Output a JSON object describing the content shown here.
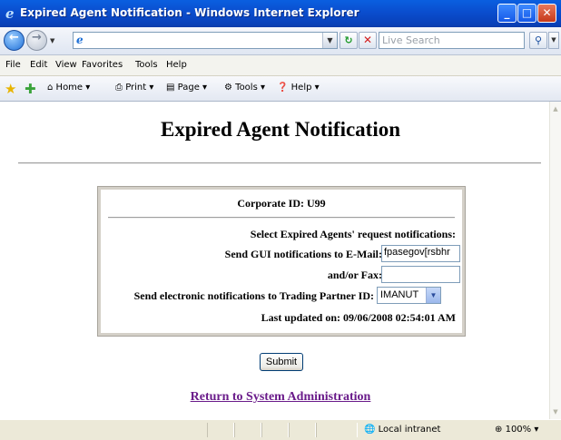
{
  "window": {
    "title": "Expired Agent Notification - Windows Internet Explorer",
    "minimize": "_",
    "maximize": "□",
    "close": "✕"
  },
  "address_bar": {
    "search_placeholder": "Live Search"
  },
  "menu": {
    "items": [
      "File",
      "Edit",
      "View",
      "Favorites",
      "Tools",
      "Help"
    ]
  },
  "command_bar": {
    "home": "Home",
    "print": "Print",
    "page": "Page",
    "tools": "Tools",
    "help": "Help"
  },
  "page": {
    "title": "Expired Agent Notification",
    "corporate_id": "Corporate ID: U99",
    "select_heading": "Select Expired Agents' request notifications:",
    "gui_email_label": "Send GUI notifications to E-Mail:",
    "gui_email_value": "fpasegov[rsbhr",
    "fax_label": "and/or Fax:",
    "fax_value": "",
    "trading_partner_label": "Send electronic notifications to Trading Partner ID:",
    "trading_partner_value": "IMANUT",
    "last_updated": "Last updated on: 09/06/2008 02:54:01 AM",
    "submit_label": "Submit",
    "return_link": "Return to System Administration"
  },
  "status_bar": {
    "zone": "Local intranet",
    "zoom": "100%"
  },
  "colors": {
    "link_visited": "#6a1b8a",
    "titlebar": "#0a4fd0"
  }
}
